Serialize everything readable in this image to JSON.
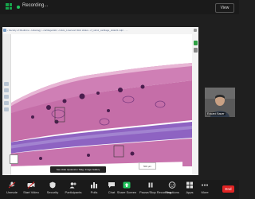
{
  "top_bar": {
    "recording_label": "Recording...",
    "view_label": "View"
  },
  "browser": {
    "breadcrumb": "‹  Faculty of Medicine  ›  Histology  ›  cartilage/skin  ›  Histo_Liverwort-Skin slides  ›  cf_skin1_cartilage_slide01.ndpi · …",
    "slide_annotation": "See slide dynamics / Mag. Image Gallery",
    "scale_text": "500 μm"
  },
  "participant": {
    "name": "Eduard Bauer"
  },
  "toolbar": {
    "items": [
      {
        "icon": "microphone-icon",
        "label": "Unmute"
      },
      {
        "icon": "video-camera-icon",
        "label": "Start Video"
      },
      {
        "icon": "security-shield-icon",
        "label": "Security"
      },
      {
        "icon": "participants-icon",
        "label": "Participants"
      },
      {
        "icon": "polls-icon",
        "label": "Polls"
      },
      {
        "icon": "chat-icon",
        "label": "Chat"
      },
      {
        "icon": "share-screen-icon",
        "label": "Share Screen"
      },
      {
        "icon": "pause-recording-icon",
        "label": "Pause/Stop Recording"
      },
      {
        "icon": "reactions-icon",
        "label": "Reactions"
      },
      {
        "icon": "apps-icon",
        "label": "Apps"
      },
      {
        "icon": "more-icon",
        "label": "More"
      }
    ],
    "end_label": "End"
  },
  "colors": {
    "toolbar_bg": "#1a1a1a",
    "end_red": "#e02424",
    "recording_green": "#22c55e",
    "tissue_pink": "#c777b0",
    "cartilage_purple": "#8b5fc0"
  }
}
